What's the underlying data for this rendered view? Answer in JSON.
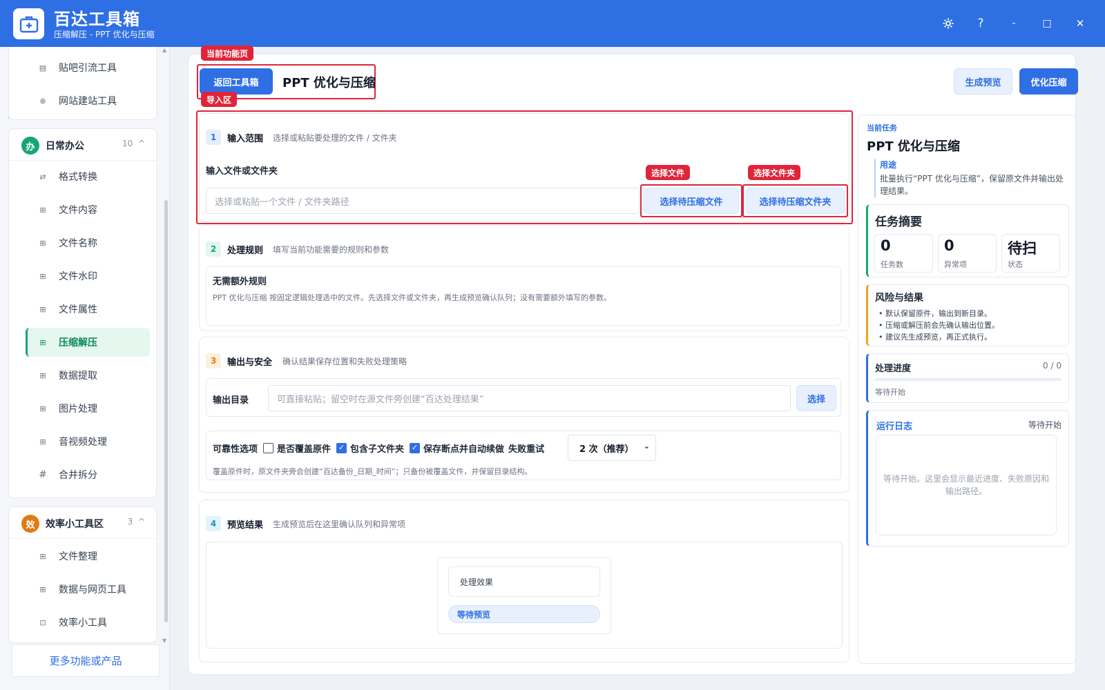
{
  "app": {
    "title": "百达工具箱",
    "subtitle": "压缩解压 - PPT 优化与压缩"
  },
  "window_controls": {
    "settings_icon": "gear-icon",
    "help": "?",
    "minimize": "-",
    "maximize": "□",
    "close": "✕"
  },
  "sidebar": {
    "group_top_items": [
      {
        "icon": "doc-icon",
        "label": "贴吧引流工具"
      },
      {
        "icon": "globe-icon",
        "label": "网站建站工具"
      }
    ],
    "group_office": {
      "badge": "办",
      "title": "日常办公",
      "count": "10",
      "chevron": "^",
      "items": [
        {
          "icon": "swap-icon",
          "label": "格式转换"
        },
        {
          "icon": "grid-icon",
          "label": "文件内容"
        },
        {
          "icon": "grid-icon",
          "label": "文件名称"
        },
        {
          "icon": "grid-icon",
          "label": "文件水印"
        },
        {
          "icon": "grid-icon",
          "label": "文件属性"
        },
        {
          "icon": "grid-icon",
          "label": "压缩解压",
          "active": true
        },
        {
          "icon": "grid-icon",
          "label": "数据提取"
        },
        {
          "icon": "grid-icon",
          "label": "图片处理"
        },
        {
          "icon": "grid-icon",
          "label": "音视频处理"
        },
        {
          "icon": "hash-icon",
          "label": "合并拆分"
        }
      ]
    },
    "group_efficiency": {
      "badge": "效",
      "title": "效率小工具区",
      "count": "3",
      "chevron": "^",
      "items": [
        {
          "icon": "grid-icon",
          "label": "文件整理"
        },
        {
          "icon": "grid-icon",
          "label": "数据与网页工具"
        },
        {
          "icon": "box-icon",
          "label": "效率小工具"
        }
      ]
    },
    "more_button": "更多功能或产品"
  },
  "annotations": {
    "current_page": "当前功能页",
    "import_area": "导入区",
    "select_file": "选择文件",
    "select_folder": "选择文件夹"
  },
  "header": {
    "back_button": "返回工具箱",
    "page_title": "PPT 优化与压缩",
    "preview_button": "生成预览",
    "run_button": "优化压缩"
  },
  "section1": {
    "num": "1",
    "title": "输入范围",
    "desc": "选择或粘贴要处理的文件 / 文件夹",
    "field_label": "输入文件或文件夹",
    "placeholder": "选择或粘贴一个文件 / 文件夹路径",
    "select_file_button": "选择待压缩文件",
    "select_folder_button": "选择待压缩文件夹"
  },
  "section2": {
    "num": "2",
    "title": "处理规则",
    "desc": "填写当前功能需要的规则和参数",
    "box_title": "无需额外规则",
    "box_text": "PPT 优化与压缩 按固定逻辑处理选中的文件。先选择文件或文件夹，再生成预览确认队列；没有需要额外填写的参数。"
  },
  "section3": {
    "num": "3",
    "title": "输出与安全",
    "desc": "确认结果保存位置和失败处理策略",
    "output_label": "输出目录",
    "output_placeholder": "可直接粘贴；留空时在源文件旁创建“百达处理结果”",
    "choose_button": "选择",
    "reliability_label": "可靠性选项",
    "opt_overwrite": "是否覆盖原件",
    "opt_subfolders": "包含子文件夹",
    "opt_resume": "保存断点并自动续做",
    "retry_label": "失败重试",
    "retry_value": "2 次（推荐）",
    "note": "覆盖原件时，原文件夹旁会创建“百达备份_日期_时间”；只备份被覆盖文件，并保留目录结构。"
  },
  "section4": {
    "num": "4",
    "title": "预览结果",
    "desc": "生成预览后在这里确认队列和异常项",
    "effect_label": "处理效果",
    "status_pill": "等待预览"
  },
  "right": {
    "eyebrow": "当前任务",
    "title": "PPT 优化与压缩",
    "usage_label": "用途",
    "usage_text": "批量执行“PPT 优化与压缩”，保留原文件并输出处理结果。",
    "summary_title": "任务摘要",
    "stats": [
      {
        "value": "0",
        "label": "任务数"
      },
      {
        "value": "0",
        "label": "异常项"
      },
      {
        "value": "待扫",
        "label": "状态"
      }
    ],
    "risk_title": "风险与结果",
    "risk_items": [
      "默认保留原件，输出到新目录。",
      "压缩或解压前会先确认输出位置。",
      "建议先生成预览，再正式执行。"
    ],
    "progress_title": "处理进度",
    "progress_count": "0 / 0",
    "progress_value": 0,
    "progress_status": "等待开始",
    "log_title": "运行日志",
    "log_status": "等待开始",
    "log_placeholder": "等待开始。这里会显示最近进度、失败原因和输出路径。"
  },
  "colors": {
    "brand": "#2f6fe4",
    "annotation": "#e0243a",
    "active_green": "#17a673",
    "risk_accent": "#f0a020"
  }
}
